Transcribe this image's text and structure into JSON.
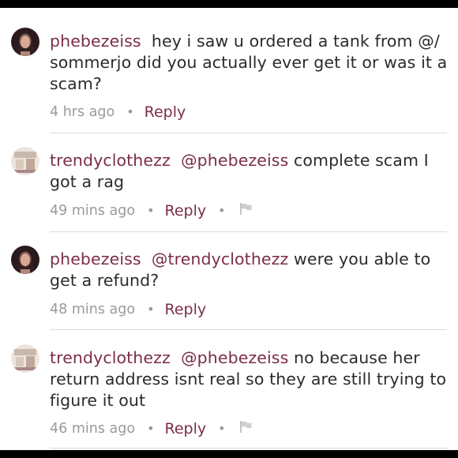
{
  "comments": [
    {
      "username": "phebezeiss",
      "mention": "",
      "text_line1": "hey i saw u ordered a tank from @/",
      "text_rest": "sommerjo did you actually ever get it or was it a scam?",
      "time": "4 hrs ago",
      "reply_label": "Reply",
      "avatar": "dark-haired-girl-avatar",
      "flag": false
    },
    {
      "username": "trendyclothezz",
      "mention": "@phebezeiss",
      "text": "complete scam I got a rag",
      "time": "49 mins ago",
      "reply_label": "Reply",
      "avatar": "clothing-shop-avatar",
      "flag": true
    },
    {
      "username": "phebezeiss",
      "mention": "@trendyclothezz",
      "text": "were you able to get a refund?",
      "time": "48 mins ago",
      "reply_label": "Reply",
      "avatar": "dark-haired-girl-avatar",
      "flag": false
    },
    {
      "username": "trendyclothezz",
      "mention": "@phebezeiss",
      "text": "no because her return address isnt real so they are still trying to figure it out",
      "time": "46 mins ago",
      "reply_label": "Reply",
      "avatar": "clothing-shop-avatar",
      "flag": true
    }
  ],
  "colors": {
    "username": "#7b2e47",
    "text": "#2b2b2b",
    "meta": "#9a9a9a",
    "divider": "#dcdcdc"
  }
}
